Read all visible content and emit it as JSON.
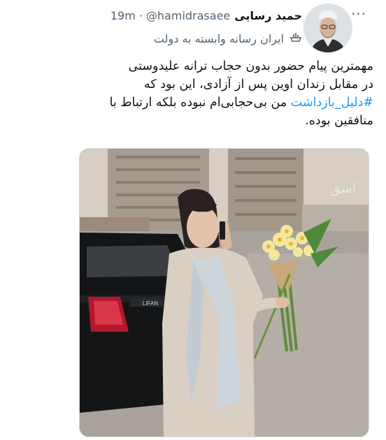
{
  "tweet": {
    "author_name": "حمید رسایی",
    "handle": "@hamidrasaee",
    "separator": "·",
    "time": "19m",
    "label": "ایران رسانه وابسته به دولت",
    "text_line1": "مهمترین پیام حضور بدون حجاب  ترانه علیدوستی",
    "text_line2": "در مقابل زندان اوین پس از آزادی، این بود که",
    "hashtag": "#دلیل_بازداشت",
    "text_line3_rest": " من بی‌حجابی‌ام نبوده بلکه ارتباط با",
    "text_line4": "منافقین بوده.",
    "more_icon": "more-horizontal-icon",
    "label_icon": "state-media-icon"
  },
  "media": {
    "watermark": "اسق",
    "car_badge": "LIFAN"
  },
  "colors": {
    "text": "#0f1419",
    "secondary": "#536471",
    "link": "#1d9bf0"
  }
}
